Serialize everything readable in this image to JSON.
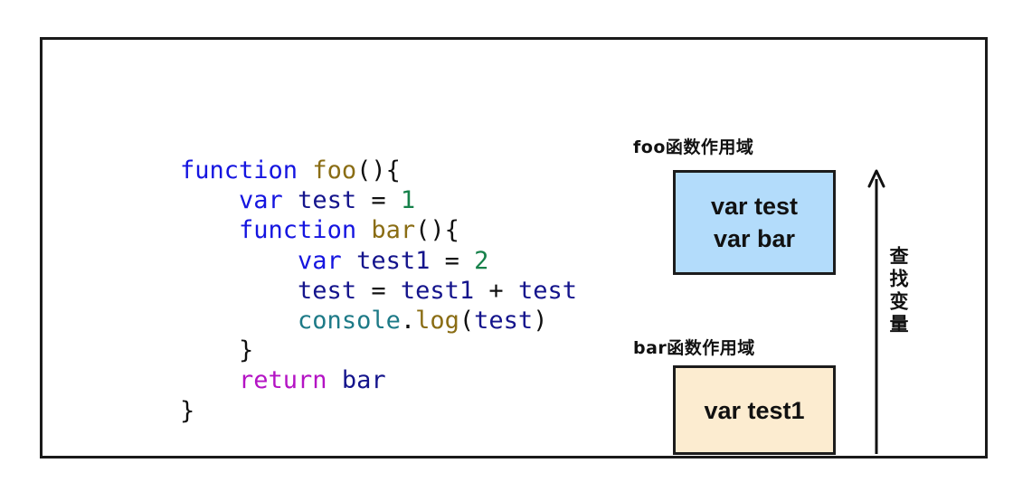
{
  "diagram": {
    "title": "JavaScript scope chain diagram",
    "frame": {
      "style": "hand-drawn-rectangle"
    },
    "code": {
      "language": "javascript",
      "lines": [
        {
          "indent": 0,
          "tokens": [
            {
              "t": "function",
              "c": "kw"
            },
            {
              "t": " ",
              "c": "punc"
            },
            {
              "t": "foo",
              "c": "fn"
            },
            {
              "t": "(){",
              "c": "punc"
            }
          ]
        },
        {
          "indent": 1,
          "tokens": [
            {
              "t": "var",
              "c": "kw"
            },
            {
              "t": " ",
              "c": "punc"
            },
            {
              "t": "test",
              "c": "id"
            },
            {
              "t": " ",
              "c": "punc"
            },
            {
              "t": "=",
              "c": "punc"
            },
            {
              "t": " ",
              "c": "punc"
            },
            {
              "t": "1",
              "c": "num"
            }
          ]
        },
        {
          "indent": 1,
          "tokens": [
            {
              "t": "function",
              "c": "kw"
            },
            {
              "t": " ",
              "c": "punc"
            },
            {
              "t": "bar",
              "c": "fn"
            },
            {
              "t": "(){",
              "c": "punc"
            }
          ]
        },
        {
          "indent": 2,
          "tokens": [
            {
              "t": "var",
              "c": "kw"
            },
            {
              "t": " ",
              "c": "punc"
            },
            {
              "t": "test1",
              "c": "id"
            },
            {
              "t": " ",
              "c": "punc"
            },
            {
              "t": "=",
              "c": "punc"
            },
            {
              "t": " ",
              "c": "punc"
            },
            {
              "t": "2",
              "c": "num"
            }
          ]
        },
        {
          "indent": 2,
          "tokens": [
            {
              "t": "test",
              "c": "id"
            },
            {
              "t": " ",
              "c": "punc"
            },
            {
              "t": "=",
              "c": "punc"
            },
            {
              "t": " ",
              "c": "punc"
            },
            {
              "t": "test1",
              "c": "id"
            },
            {
              "t": " ",
              "c": "punc"
            },
            {
              "t": "+",
              "c": "punc"
            },
            {
              "t": " ",
              "c": "punc"
            },
            {
              "t": "test",
              "c": "id"
            }
          ]
        },
        {
          "indent": 2,
          "tokens": [
            {
              "t": "console",
              "c": "obj"
            },
            {
              "t": ".",
              "c": "punc"
            },
            {
              "t": "log",
              "c": "fn"
            },
            {
              "t": "(",
              "c": "punc"
            },
            {
              "t": "test",
              "c": "id"
            },
            {
              "t": ")",
              "c": "punc"
            }
          ]
        },
        {
          "indent": 1,
          "tokens": [
            {
              "t": "}",
              "c": "punc"
            }
          ]
        },
        {
          "indent": 1,
          "tokens": [
            {
              "t": "return",
              "c": "ret"
            },
            {
              "t": " ",
              "c": "punc"
            },
            {
              "t": "bar",
              "c": "id"
            }
          ]
        },
        {
          "indent": 0,
          "tokens": [
            {
              "t": "}",
              "c": "punc"
            }
          ]
        }
      ]
    },
    "scopes": [
      {
        "id": "foo",
        "label": "foo函数作用域",
        "fill": "#b3dcfb",
        "border": "#1c1c1c",
        "entries": [
          "var test",
          "var bar"
        ]
      },
      {
        "id": "bar",
        "label": "bar函数作用域",
        "fill": "#fcecd0",
        "border": "#1c1c1c",
        "entries": [
          "var test1"
        ]
      }
    ],
    "arrow": {
      "direction": "up",
      "label": "查找变量",
      "color": "#111111"
    }
  }
}
